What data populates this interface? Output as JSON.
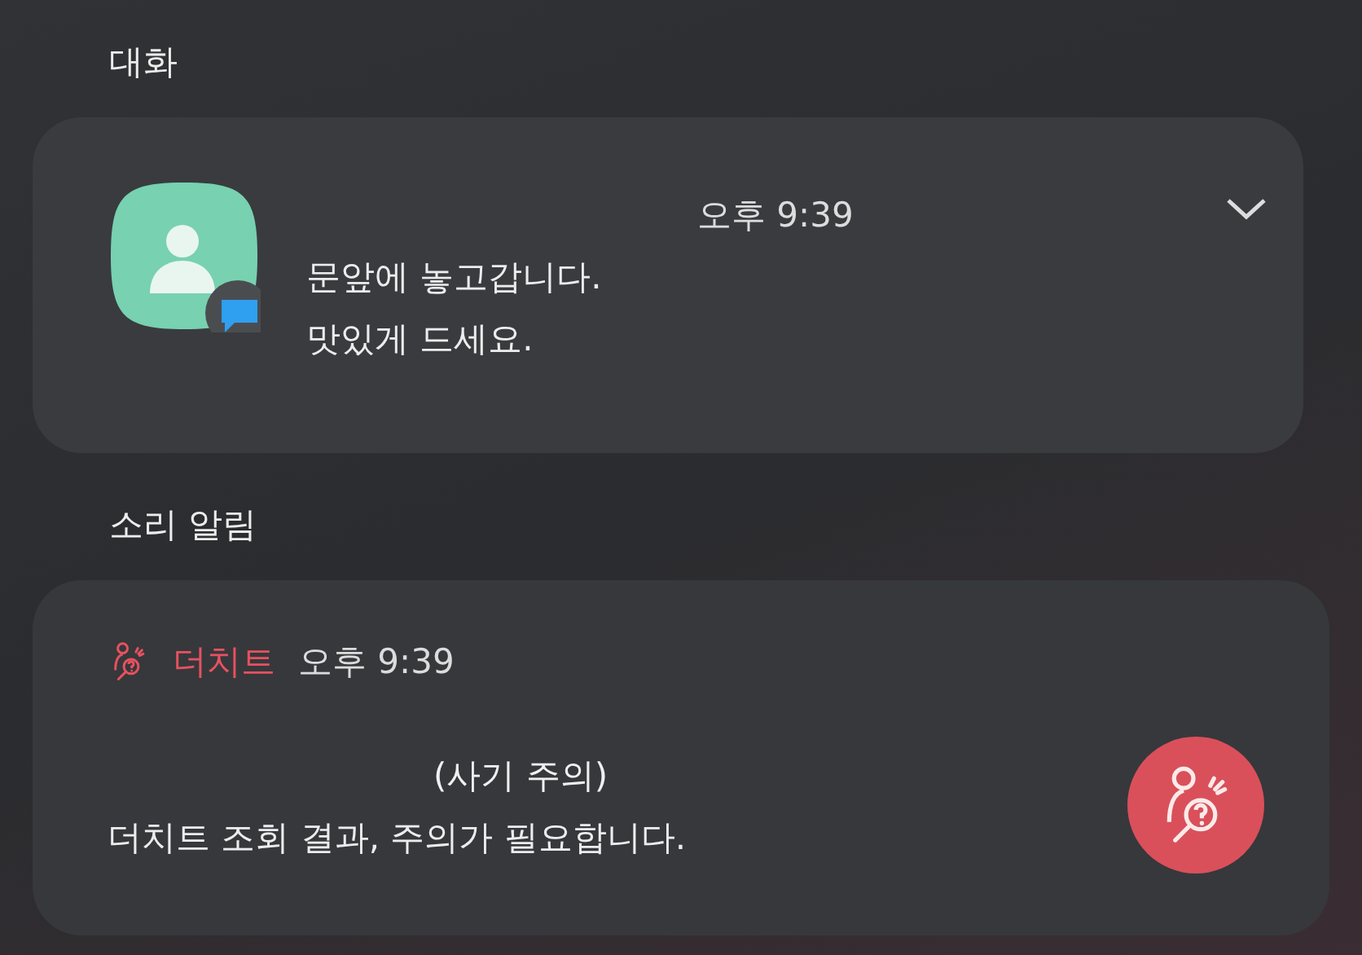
{
  "sections": [
    {
      "kind": "conversation",
      "title": "대화",
      "time": "오후 9:39",
      "messages": [
        "문앞에 놓고갑니다.",
        "맛있게 드세요."
      ]
    },
    {
      "kind": "alert",
      "title": "소리 알림",
      "app": "더치트",
      "time": "오후 9:39",
      "heading": "(사기 주의)",
      "body": "더치트 조회 결과, 주의가 필요합니다."
    }
  ]
}
